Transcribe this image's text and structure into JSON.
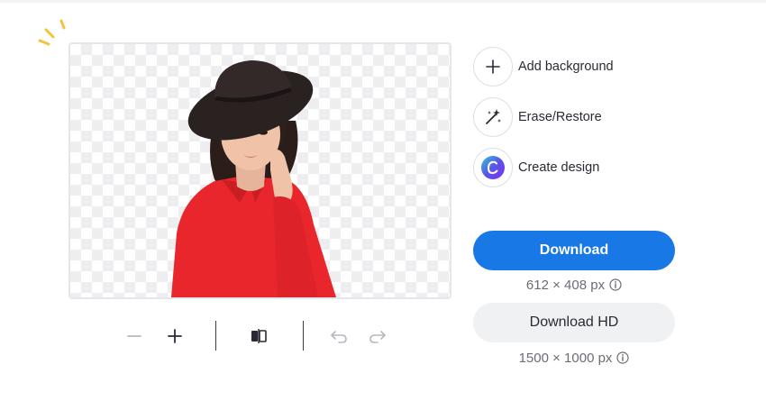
{
  "actions": {
    "add_background": "Add background",
    "erase_restore": "Erase/Restore",
    "create_design": "Create design"
  },
  "download": {
    "label": "Download",
    "dimensions": "612 × 408 px"
  },
  "download_hd": {
    "label": "Download HD",
    "dimensions": "1500 × 1000 px"
  },
  "colors": {
    "primary": "#1778e6",
    "secondary_bg": "#f0f1f3",
    "sparkle": "#f5c23c",
    "shirt": "#e8262c"
  },
  "icons": [
    "sparkle-icon",
    "plus-icon",
    "magic-wand-icon",
    "canva-logo-icon",
    "info-icon",
    "zoom-out-icon",
    "zoom-in-icon",
    "compare-icon",
    "undo-icon",
    "redo-icon"
  ]
}
